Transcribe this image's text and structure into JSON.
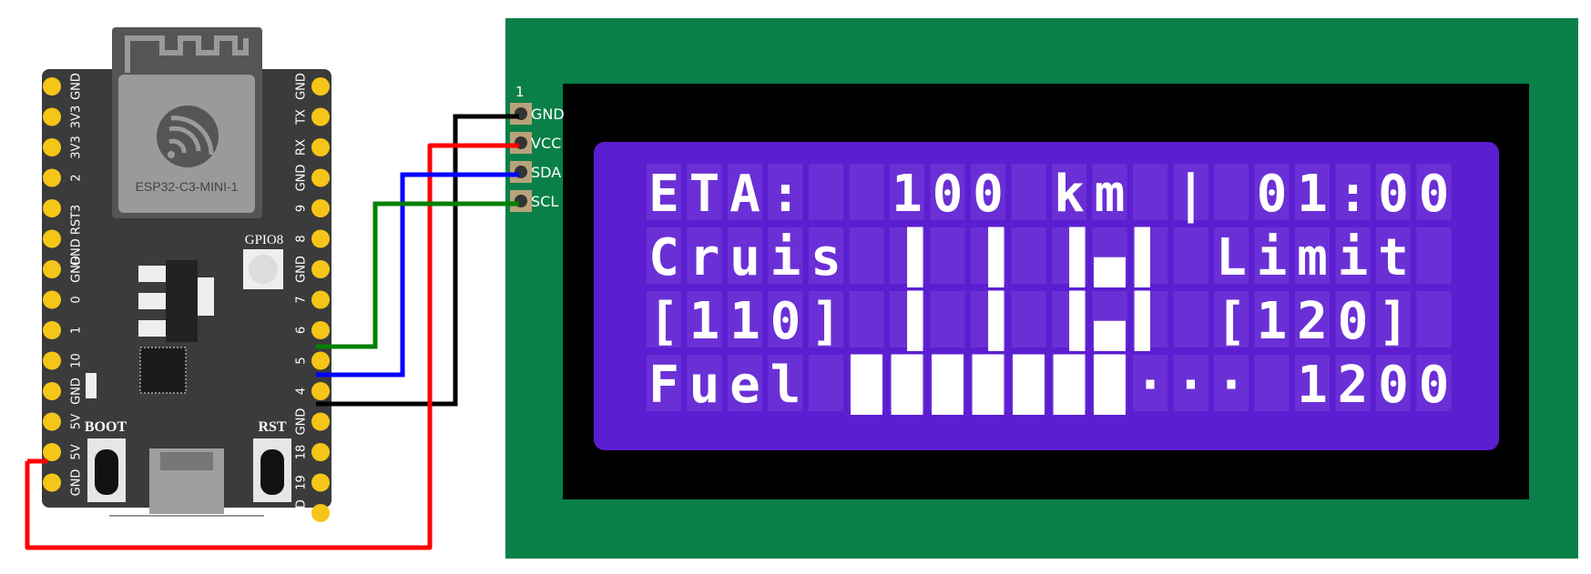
{
  "board": {
    "module_label": "ESP32-C3-MINI-1",
    "led_label": "GPIO8",
    "boot_label": "BOOT",
    "rst_label": "RST",
    "left_pins": [
      "GND",
      "3V3",
      "3V3",
      "2",
      "3",
      "GND RST",
      "GND",
      "0",
      "1",
      "10",
      "GND",
      "5V",
      "5V",
      "GND"
    ],
    "right_pins": [
      "GND",
      "TX",
      "RX",
      "GND",
      "9",
      "8",
      "GND",
      "7",
      "6",
      "5",
      "4",
      "GND",
      "18",
      "19",
      "GND"
    ],
    "colors": {
      "pcb": "#3b3b3b",
      "pin": "#f5c518",
      "module": "#9a9a9a"
    }
  },
  "lcd": {
    "pin1_marker": "1",
    "pins": [
      "GND",
      "VCC",
      "SDA",
      "SCL"
    ],
    "rows": [
      "ETA:  100 km | 01:00",
      "Cruis ▐ ▐ ▐▄▌ Limit",
      "[110] ▐ ▐ ▐▄▌ [120]",
      "Fuel ███████··· 1200"
    ],
    "colors": {
      "board": "#0a8048",
      "bezel": "#000000",
      "screen": "#5b1fd1",
      "cell": "#6a30d6",
      "pixel": "#ffffff"
    }
  },
  "wires": {
    "colors": {
      "gnd": "#000000",
      "vcc": "#ff0000",
      "sda": "#0000ff",
      "scl": "#008000"
    }
  }
}
